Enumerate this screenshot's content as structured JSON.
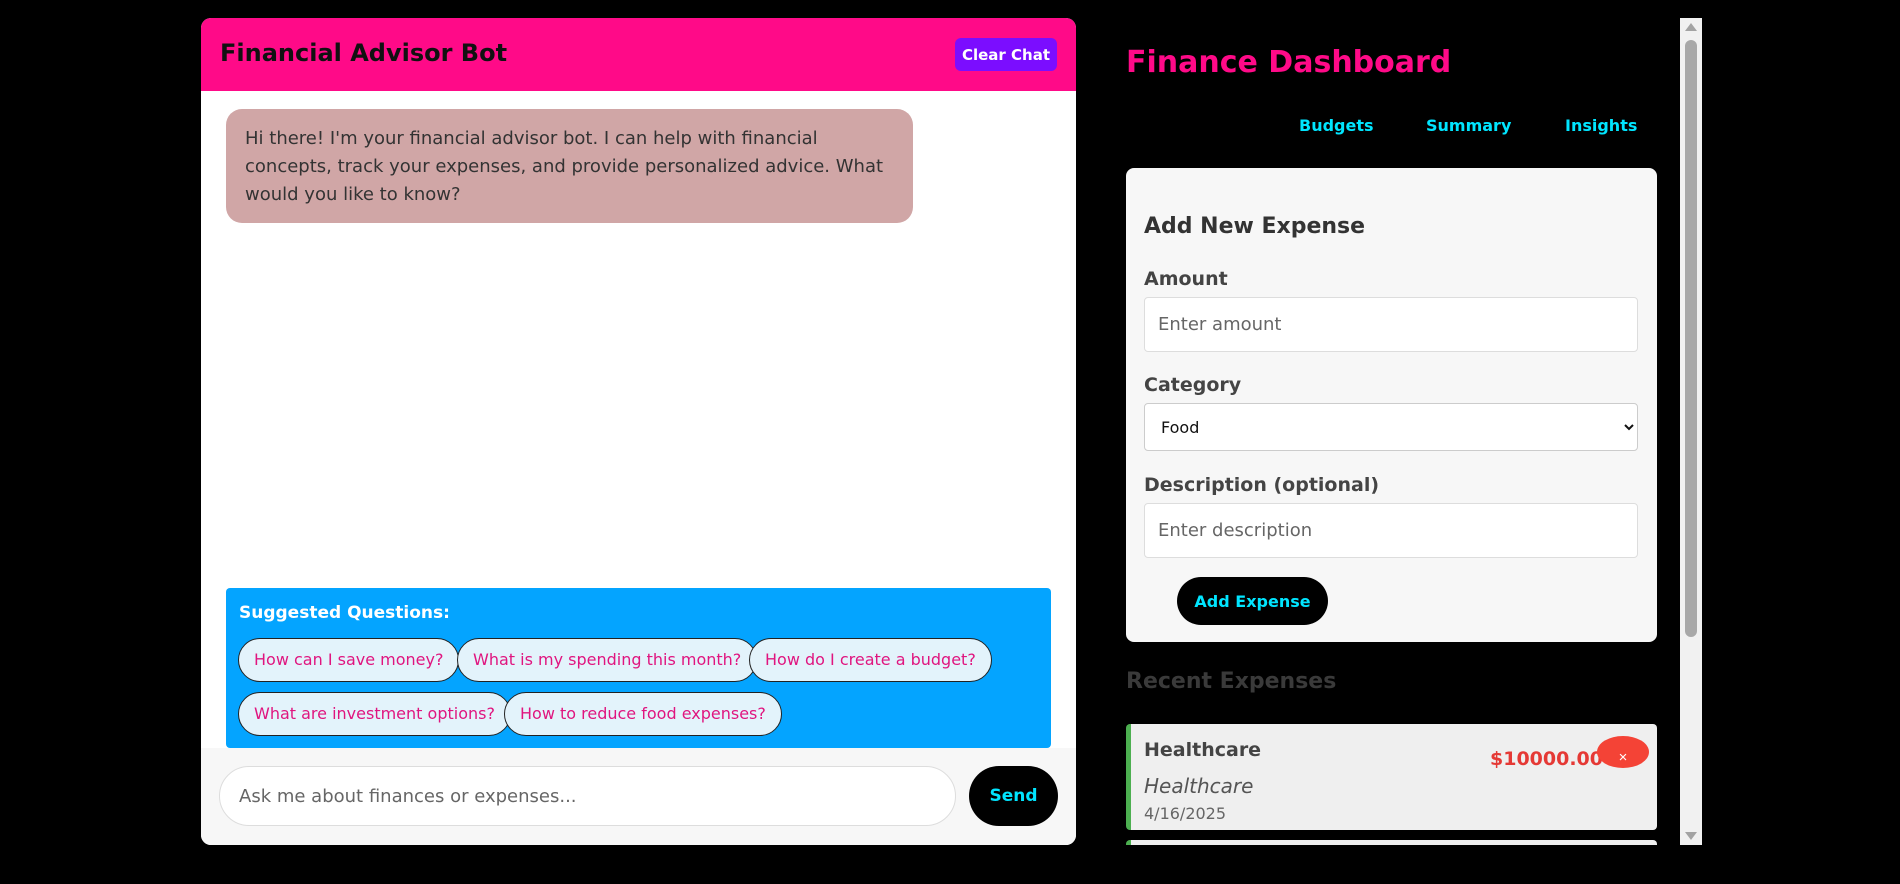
{
  "chat": {
    "title": "Financial Advisor Bot",
    "clear_label": "Clear Chat",
    "bot_message": "Hi there! I'm your financial advisor bot. I can help with financial concepts, track your expenses, and provide personalized advice. What would you like to know?",
    "suggested_title": "Suggested Questions:",
    "suggestions": [
      "How can I save money?",
      "What is my spending this month?",
      "How do I create a budget?",
      "What are investment options?",
      "How to reduce food expenses?"
    ],
    "input_placeholder": "Ask me about finances or expenses...",
    "send_label": "Send"
  },
  "dashboard": {
    "title": "Finance Dashboard",
    "tabs": [
      "Budgets",
      "Summary",
      "Insights"
    ],
    "form": {
      "title": "Add New Expense",
      "amount_label": "Amount",
      "amount_placeholder": "Enter amount",
      "category_label": "Category",
      "category_value": "Food",
      "description_label": "Description (optional)",
      "description_placeholder": "Enter description",
      "submit_label": "Add Expense"
    },
    "recent_title": "Recent Expenses",
    "expenses": [
      {
        "name": "Healthcare",
        "category": "Healthcare",
        "date": "4/16/2025",
        "amount": "$10000.00",
        "delete_label": "×"
      }
    ]
  },
  "colors": {
    "accent_pink": "#ff0a88",
    "accent_cyan": "#00e5ff",
    "suggest_blue": "#04a4ff",
    "clear_purple": "#7b0dff"
  }
}
